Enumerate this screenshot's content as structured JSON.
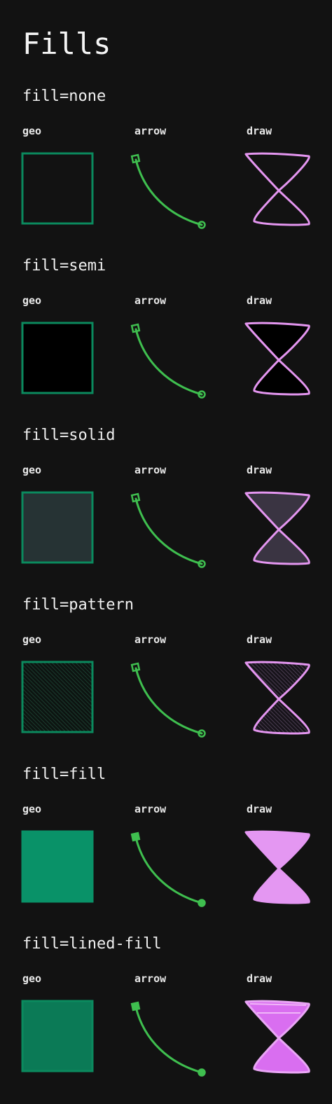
{
  "title": "Fills",
  "colors": {
    "background": "#121212",
    "geo_stroke": "#0b8a5e",
    "arrow_stroke": "#3fbf4f",
    "draw_stroke": "#e496f0"
  },
  "sections": [
    {
      "heading": "fill=none",
      "fill_style": "none",
      "columns": {
        "geo": "geo",
        "arrow": "arrow",
        "draw": "draw"
      }
    },
    {
      "heading": "fill=semi",
      "fill_style": "semi",
      "columns": {
        "geo": "geo",
        "arrow": "arrow",
        "draw": "draw"
      }
    },
    {
      "heading": "fill=solid",
      "fill_style": "solid",
      "columns": {
        "geo": "geo",
        "arrow": "arrow",
        "draw": "draw"
      }
    },
    {
      "heading": "fill=pattern",
      "fill_style": "pattern",
      "columns": {
        "geo": "geo",
        "arrow": "arrow",
        "draw": "draw"
      }
    },
    {
      "heading": "fill=fill",
      "fill_style": "fill",
      "columns": {
        "geo": "geo",
        "arrow": "arrow",
        "draw": "draw"
      }
    },
    {
      "heading": "fill=lined-fill",
      "fill_style": "lined-fill",
      "columns": {
        "geo": "geo",
        "arrow": "arrow",
        "draw": "draw"
      }
    }
  ]
}
